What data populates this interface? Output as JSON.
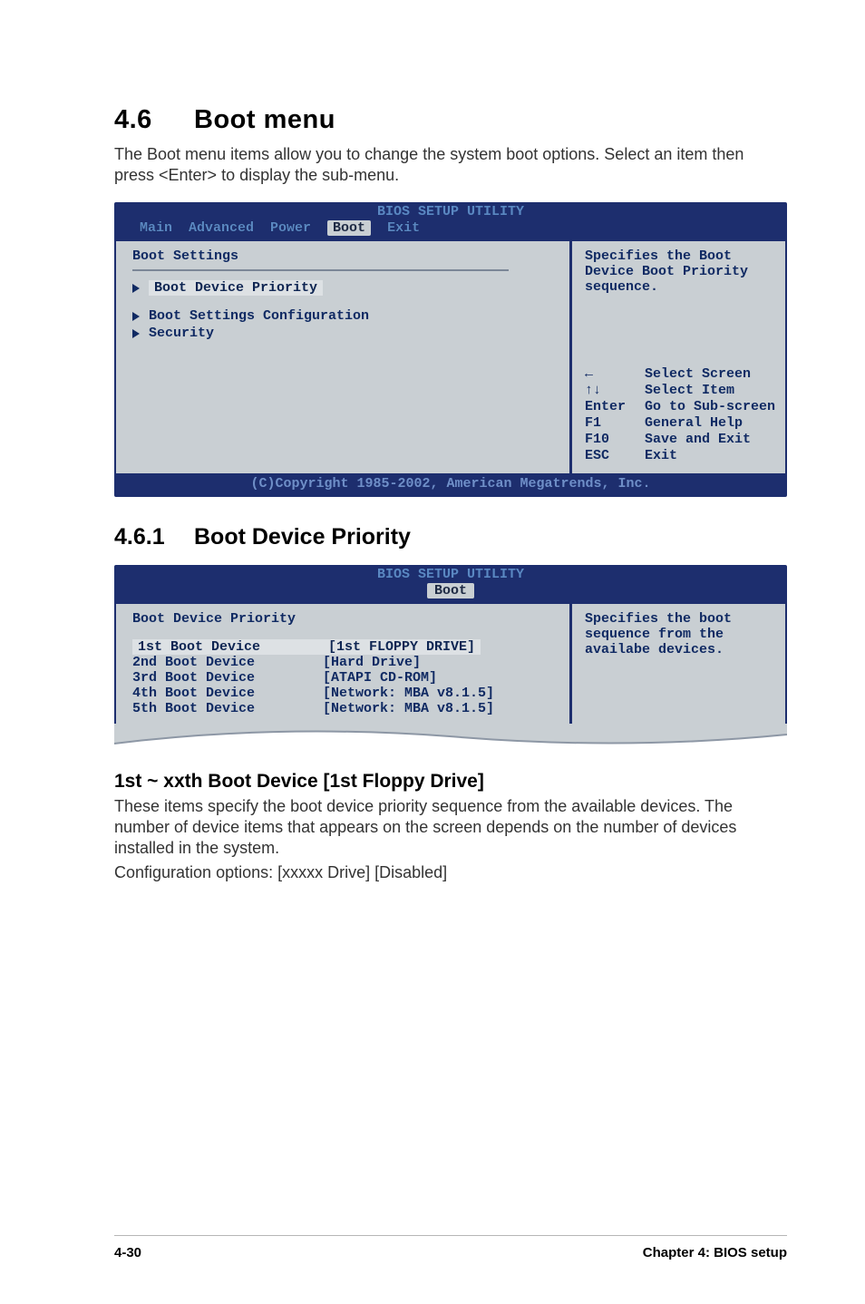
{
  "section": {
    "num": "4.6",
    "title": "Boot menu"
  },
  "intro": "The Boot menu items allow you to change the system boot options. Select an item then press <Enter> to display the sub-menu.",
  "bios1": {
    "header": "BIOS SETUP UTILITY",
    "tabs": [
      "Main",
      "Advanced",
      "Power",
      "Boot",
      "Exit"
    ],
    "active_tab": "Boot",
    "left_title": "Boot Settings",
    "items": [
      {
        "label": "Boot Device Priority",
        "selected": true
      },
      {
        "label": "Boot Settings Configuration",
        "selected": false
      },
      {
        "label": "Security",
        "selected": false
      }
    ],
    "help_top": "Specifies the Boot Device Boot Priority sequence.",
    "keys": [
      {
        "k": "←",
        "v": "Select Screen"
      },
      {
        "k": "↑↓",
        "v": "Select Item"
      },
      {
        "k": "Enter",
        "v": "Go to Sub-screen"
      },
      {
        "k": "F1",
        "v": "General Help"
      },
      {
        "k": "F10",
        "v": "Save and Exit"
      },
      {
        "k": "ESC",
        "v": "Exit"
      }
    ],
    "copyright": "(C)Copyright 1985-2002, American Megatrends, Inc."
  },
  "sub461": {
    "num": "4.6.1",
    "title": "Boot Device Priority"
  },
  "bios2": {
    "header": "BIOS SETUP UTILITY",
    "tab": "Boot",
    "left_title": "Boot Device Priority",
    "rows": [
      {
        "k": "1st Boot Device",
        "v": "[1st FLOPPY DRIVE]"
      },
      {
        "k": "2nd Boot Device",
        "v": "[Hard Drive]"
      },
      {
        "k": "3rd Boot Device",
        "v": "[ATAPI CD-ROM]"
      },
      {
        "k": "4th Boot Device",
        "v": "[Network: MBA v8.1.5]"
      },
      {
        "k": "5th Boot Device",
        "v": "[Network: MBA v8.1.5]"
      }
    ],
    "help": "Specifies the boot sequence from the availabe devices."
  },
  "sub1st": {
    "title": "1st ~ xxth Boot Device [1st Floppy Drive]",
    "body1": "These items specify the boot device priority sequence from the available devices. The number of device items that appears on the screen depends on the number of devices installed in the system.",
    "body2": "Configuration options: [xxxxx Drive] [Disabled]"
  },
  "footer": {
    "left": "4-30",
    "right": "Chapter 4: BIOS setup"
  }
}
